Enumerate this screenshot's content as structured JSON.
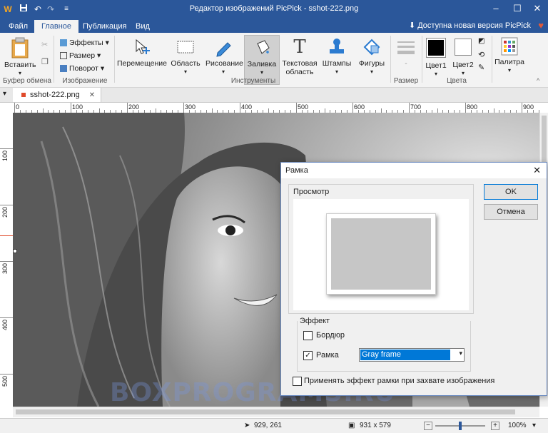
{
  "window": {
    "title": "Редактор изображений PicPick - sshot-222.png",
    "controls": [
      "–",
      "☐",
      "✕"
    ]
  },
  "menu_tabs": [
    "Файл",
    "Главное",
    "Публикация",
    "Вид"
  ],
  "active_tab": "Главное",
  "update_notice": "Доступна новая версия PicPick",
  "ribbon": {
    "clipboard": {
      "paste": "Вставить",
      "group": "Буфер обмена"
    },
    "image": {
      "effects": "Эффекты",
      "size": "Размер",
      "rotate": "Поворот",
      "group": "Изображение"
    },
    "tools": {
      "move": "Перемещение",
      "region": "Область",
      "draw": "Рисование",
      "fill": "Заливка",
      "text_line1": "Текстовая",
      "text_line2": "область",
      "stamps": "Штампы",
      "shapes": "Фигуры",
      "group": "Инструменты"
    },
    "size": {
      "value": "-",
      "group": "Размер"
    },
    "colors": {
      "color1": "Цвет1",
      "color2": "Цвет2",
      "group": "Цвета"
    },
    "palette": {
      "label": "Палитра"
    }
  },
  "document_tab": {
    "name": "sshot-222.png",
    "close": "✕"
  },
  "ruler_h": [
    "0",
    "100",
    "200",
    "300",
    "400",
    "500",
    "600",
    "700",
    "800",
    "900"
  ],
  "ruler_v": [
    "100",
    "200",
    "300",
    "400",
    "500"
  ],
  "dialog": {
    "title": "Рамка",
    "close": "✕",
    "preview_label": "Просмотр",
    "ok": "OK",
    "cancel": "Отмена",
    "effect_label": "Эффект",
    "border_label": "Бордюр",
    "border_checked": false,
    "frame_label": "Рамка",
    "frame_checked": true,
    "frame_select": "Gray frame",
    "apply_label": "Применять эффект рамки при захвате изображения",
    "apply_checked": false
  },
  "watermark": "BOXPROGRAMS.RU",
  "status": {
    "cursor": "929, 261",
    "size": "931 x 579",
    "zoom": "100%",
    "zoom_level": 0.5
  },
  "colors": {
    "accent": "#2b579a",
    "heart": "#e05a3a",
    "color1": "#000000",
    "color2": "#ffffff",
    "select_highlight": "#0078d7"
  }
}
